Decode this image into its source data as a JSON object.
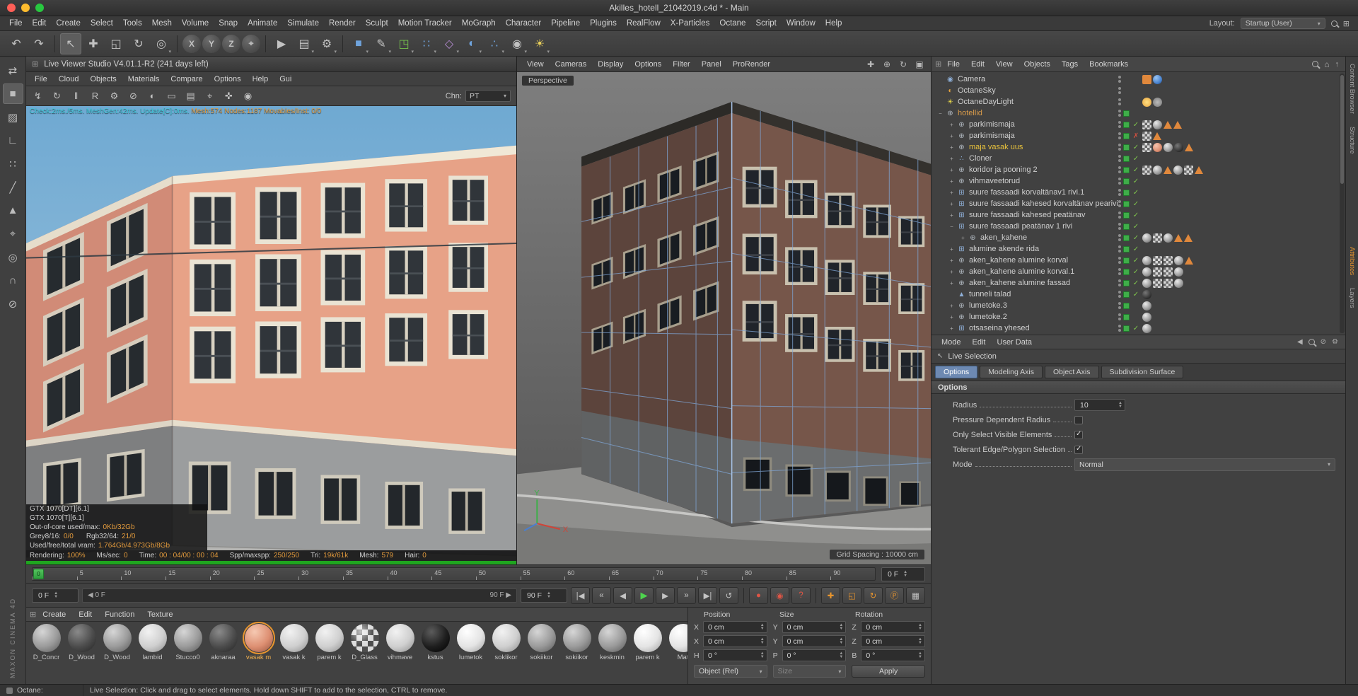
{
  "window": {
    "title": "Akilles_hotell_21042019.c4d * - Main"
  },
  "menu_bar": {
    "items": [
      "File",
      "Edit",
      "Create",
      "Select",
      "Tools",
      "Mesh",
      "Volume",
      "Snap",
      "Animate",
      "Simulate",
      "Render",
      "Sculpt",
      "Motion Tracker",
      "MoGraph",
      "Character",
      "Pipeline",
      "Plugins",
      "RealFlow",
      "X-Particles",
      "Octane",
      "Script",
      "Window",
      "Help"
    ],
    "layout_label": "Layout:",
    "layout_value": "Startup (User)"
  },
  "toolbar": {
    "buttons": [
      {
        "name": "undo-icon",
        "glyph": "↶"
      },
      {
        "name": "redo-icon",
        "glyph": "↷"
      },
      {
        "name": "separator",
        "cls": "sep"
      },
      {
        "name": "live-selection-tool-icon",
        "glyph": "↖",
        "cls": "active"
      },
      {
        "name": "move-tool-icon",
        "glyph": "✚"
      },
      {
        "name": "scale-tool-icon",
        "glyph": "◱"
      },
      {
        "name": "rotate-tool-icon",
        "glyph": "↻"
      },
      {
        "name": "last-used-tool-icon",
        "glyph": "◎",
        "caret": true
      },
      {
        "name": "separator",
        "cls": "sep"
      },
      {
        "name": "x-axis-lock-button",
        "glyph": "X",
        "cls": "axis"
      },
      {
        "name": "y-axis-lock-button",
        "glyph": "Y",
        "cls": "axis"
      },
      {
        "name": "z-axis-lock-button",
        "glyph": "Z",
        "cls": "axis"
      },
      {
        "name": "coordinate-system-button",
        "glyph": "⌖",
        "cls": "axis"
      },
      {
        "name": "separator",
        "cls": "sep"
      },
      {
        "name": "render-view-button",
        "glyph": "▶"
      },
      {
        "name": "render-picture-viewer-button",
        "glyph": "▤",
        "caret": true
      },
      {
        "name": "render-settings-button",
        "glyph": "⚙",
        "caret": true
      },
      {
        "name": "separator",
        "cls": "sep"
      },
      {
        "name": "primitive-cube-button",
        "glyph": "■",
        "cls": "c-blue",
        "caret": true
      },
      {
        "name": "spline-pen-button",
        "glyph": "✎",
        "caret": true
      },
      {
        "name": "subdivision-surface-button",
        "glyph": "◳",
        "cls": "c-green",
        "caret": true
      },
      {
        "name": "array-button",
        "glyph": "∷",
        "cls": "c-blue",
        "caret": true
      },
      {
        "name": "deformer-button",
        "glyph": "◇",
        "cls": "c-purple",
        "caret": true
      },
      {
        "name": "environment-button",
        "glyph": "◐",
        "cls": "c-blue",
        "caret": true
      },
      {
        "name": "mograph-button",
        "glyph": "∴",
        "cls": "c-blue",
        "caret": true
      },
      {
        "name": "camera-button",
        "glyph": "◉",
        "caret": true
      },
      {
        "name": "light-button",
        "glyph": "☀",
        "cls": "c-yellow",
        "caret": true
      }
    ]
  },
  "left_palette": {
    "tools": [
      {
        "name": "make-editable-icon",
        "glyph": "⇄"
      },
      {
        "name": "model-mode-icon",
        "glyph": "■",
        "cls": "active c-blue"
      },
      {
        "name": "texture-mode-icon",
        "glyph": "▨"
      },
      {
        "name": "workplane-mode-icon",
        "glyph": "∟"
      },
      {
        "name": "points-mode-icon",
        "glyph": "∷"
      },
      {
        "name": "edges-mode-icon",
        "glyph": "╱"
      },
      {
        "name": "polygons-mode-icon",
        "glyph": "▲"
      },
      {
        "name": "enable-axis-icon",
        "glyph": "⌖"
      },
      {
        "name": "viewport-solo-icon",
        "glyph": "◎"
      },
      {
        "name": "snap-icon",
        "glyph": "∩"
      },
      {
        "name": "lock-workplane-icon",
        "glyph": "⊘"
      }
    ]
  },
  "brand": {
    "text": "MAXON CINEMA 4D"
  },
  "live_viewer": {
    "title": "Live Viewer Studio V4.01.1-R2 (241 days left)",
    "menus": [
      "File",
      "Cloud",
      "Objects",
      "Materials",
      "Compare",
      "Options",
      "Help",
      "Gui"
    ],
    "toolbar": [
      {
        "name": "restart-render-icon",
        "glyph": "↯"
      },
      {
        "name": "refresh-render-icon",
        "glyph": "↻"
      },
      {
        "name": "pause-render-icon",
        "glyph": "‖"
      },
      {
        "name": "reset-render-button",
        "glyph": "R"
      },
      {
        "name": "settings-gear-icon",
        "glyph": "⚙"
      },
      {
        "name": "lock-resolution-icon",
        "glyph": "⊘"
      },
      {
        "name": "clay-mode-icon",
        "glyph": "◐"
      },
      {
        "name": "region-render-icon",
        "glyph": "▭"
      },
      {
        "name": "render-passes-icon",
        "glyph": "▤"
      },
      {
        "name": "focus-picker-icon",
        "glyph": "⌖"
      },
      {
        "name": "material-picker-icon",
        "glyph": "✜"
      },
      {
        "name": "camera-pin-icon",
        "glyph": "◉"
      }
    ],
    "chn_label": "Chn:",
    "chn_value": "PT",
    "overlay_left": "Check:2ms./5ms. MeshGen:42ms. Update[C]:0ms.",
    "overlay_right": "Mesh:574 Nodes:1187 Movables/Inst: 0/0",
    "gpu_rows": [
      "GTX 1070[DT][6.1]",
      "GTX 1070[T][6.1]"
    ],
    "memory_rows": [
      {
        "label": "Out-of-core used/max:",
        "value": "0Kb/32Gb",
        "label2": "",
        "value2": ""
      },
      {
        "label": "Grey8/16:",
        "value": "0/0",
        "label2": "Rgb32/64:",
        "value2": "21/0"
      },
      {
        "label": "Used/free/total vram:",
        "value": "1.764Gb/4.973Gb/8Gb",
        "label2": "",
        "value2": ""
      }
    ],
    "render_stats": [
      {
        "label": "Rendering:",
        "value": "100%"
      },
      {
        "label": "Ms/sec:",
        "value": "0"
      },
      {
        "label": "Time:",
        "value": "00 : 04/00 : 00 : 04"
      },
      {
        "label": "Spp/maxspp:",
        "value": "250/250"
      },
      {
        "label": "Tri:",
        "value": "19k/61k"
      },
      {
        "label": "Mesh:",
        "value": "579"
      },
      {
        "label": "Hair:",
        "value": "0"
      }
    ]
  },
  "viewport": {
    "menus": [
      "View",
      "Cameras",
      "Display",
      "Options",
      "Filter",
      "Panel",
      "ProRender"
    ],
    "corner_icons": [
      {
        "name": "pan-view-icon",
        "glyph": "✚"
      },
      {
        "name": "zoom-view-icon",
        "glyph": "⊕"
      },
      {
        "name": "rotate-view-icon",
        "glyph": "↻"
      },
      {
        "name": "maximize-view-icon",
        "glyph": "▣"
      }
    ],
    "label": "Perspective",
    "grid_spacing": "Grid Spacing : 10000 cm",
    "axis_x": "X",
    "axis_y": "Y"
  },
  "object_manager": {
    "menus": [
      "File",
      "Edit",
      "View",
      "Objects",
      "Tags",
      "Bookmarks"
    ],
    "items": [
      {
        "label": "Camera",
        "icon": "◉",
        "icls": "i-blue",
        "exp": "",
        "level": 0,
        "sq": false,
        "chk": "",
        "tags": [
          "comp",
          "blue"
        ]
      },
      {
        "label": "OctaneSky",
        "icon": "◐",
        "icls": "i-orange",
        "exp": "",
        "level": 0,
        "sq": false,
        "chk": "",
        "tags": []
      },
      {
        "label": "OctaneDayLight",
        "icon": "☀",
        "icls": "i-yellow",
        "exp": "",
        "level": 0,
        "sq": false,
        "chk": "",
        "tags": [
          "sun",
          "gear"
        ]
      },
      {
        "label": "hotellid",
        "icon": "⊕",
        "icls": "i-gray",
        "exp": "−",
        "level": 0,
        "color": "#d89b4a",
        "sq": true,
        "chk": "",
        "tags": []
      },
      {
        "label": "parkimismaja",
        "icon": "⊕",
        "icls": "i-gray",
        "exp": "+",
        "level": 1,
        "sq": true,
        "chk": "✓",
        "tags": [
          "check",
          "ball",
          "tri",
          "tri"
        ]
      },
      {
        "label": "parkimismaja",
        "icon": "⊕",
        "icls": "i-gray",
        "exp": "+",
        "level": 1,
        "sq": true,
        "chk": "✗",
        "cross": true,
        "tags": [
          "check",
          "tri"
        ]
      },
      {
        "label": "maja vasak uus",
        "icon": "⊕",
        "icls": "i-gray",
        "exp": "+",
        "level": 1,
        "color": "#e8c23c",
        "sq": true,
        "chk": "✓",
        "tags": [
          "check",
          "salmon",
          "ball",
          "dark",
          "tri"
        ]
      },
      {
        "label": "Cloner",
        "icon": "∴",
        "icls": "i-blue",
        "exp": "+",
        "level": 1,
        "sq": true,
        "chk": "✓",
        "tags": []
      },
      {
        "label": "koridor ja pooning 2",
        "icon": "⊕",
        "icls": "i-gray",
        "exp": "+",
        "level": 1,
        "sq": true,
        "chk": "✓",
        "tags": [
          "check",
          "ball",
          "tri",
          "ball",
          "check",
          "tri"
        ]
      },
      {
        "label": "vihmaveetorud",
        "icon": "⊕",
        "icls": "i-gray",
        "exp": "+",
        "level": 1,
        "sq": true,
        "chk": "✓",
        "tags": []
      },
      {
        "label": "suure fassaadi korvaltänav1 rivi.1",
        "icon": "⊞",
        "icls": "i-blue",
        "exp": "+",
        "level": 1,
        "sq": true,
        "chk": "✓",
        "tags": []
      },
      {
        "label": "suure fassaadi kahesed korvaltänav pearivi",
        "icon": "⊞",
        "icls": "i-blue",
        "exp": "+",
        "level": 1,
        "sq": true,
        "chk": "✓",
        "tags": []
      },
      {
        "label": "suure fassaadi kahesed peatänav",
        "icon": "⊞",
        "icls": "i-blue",
        "exp": "+",
        "level": 1,
        "sq": true,
        "chk": "✓",
        "tags": []
      },
      {
        "label": "suure fassaadi peatänav 1 rivi",
        "icon": "⊞",
        "icls": "i-blue",
        "exp": "−",
        "level": 1,
        "sq": true,
        "chk": "✓",
        "tags": []
      },
      {
        "label": "aken_kahene",
        "icon": "⊕",
        "icls": "i-gray",
        "exp": "+",
        "level": 2,
        "sq": true,
        "chk": "✓",
        "tags": [
          "ball",
          "check",
          "ball",
          "tri",
          "tri"
        ]
      },
      {
        "label": "alumine akende rida",
        "icon": "⊞",
        "icls": "i-blue",
        "exp": "+",
        "level": 1,
        "sq": true,
        "chk": "✓",
        "tags": []
      },
      {
        "label": "aken_kahene alumine korval",
        "icon": "⊕",
        "icls": "i-gray",
        "exp": "+",
        "level": 1,
        "sq": true,
        "chk": "✓",
        "tags": [
          "ball",
          "check",
          "check",
          "ball",
          "tri"
        ]
      },
      {
        "label": "aken_kahene alumine korval.1",
        "icon": "⊕",
        "icls": "i-gray",
        "exp": "+",
        "level": 1,
        "sq": true,
        "chk": "✓",
        "tags": [
          "ball",
          "check",
          "check",
          "ball"
        ]
      },
      {
        "label": "aken_kahene alumine fassad",
        "icon": "⊕",
        "icls": "i-gray",
        "exp": "+",
        "level": 1,
        "sq": true,
        "chk": "✓",
        "tags": [
          "ball",
          "check",
          "check",
          "ball"
        ]
      },
      {
        "label": "tunneli talad",
        "icon": "▲",
        "icls": "i-blue",
        "exp": "",
        "level": 1,
        "sq": true,
        "chk": "✓",
        "tags": [
          "dark"
        ]
      },
      {
        "label": "lumetoke.3",
        "icon": "⊕",
        "icls": "i-gray",
        "exp": "+",
        "level": 1,
        "sq": true,
        "chk": "",
        "tags": [
          "ball"
        ]
      },
      {
        "label": "lumetoke.2",
        "icon": "⊕",
        "icls": "i-gray",
        "exp": "+",
        "level": 1,
        "sq": true,
        "chk": "",
        "tags": [
          "ball"
        ]
      },
      {
        "label": "otsaseina yhesed",
        "icon": "⊞",
        "icls": "i-blue",
        "exp": "+",
        "level": 1,
        "sq": true,
        "chk": "✓",
        "tags": [
          "ball"
        ]
      }
    ]
  },
  "attributes": {
    "tabs": [
      "Mode",
      "Edit",
      "User Data"
    ],
    "title": "Live Selection",
    "sub_tabs": [
      {
        "label": "Options",
        "cls": "active",
        "name": "tab-options"
      },
      {
        "label": "Modeling Axis",
        "name": "tab-modeling-axis"
      },
      {
        "label": "Object Axis",
        "name": "tab-object-axis"
      },
      {
        "label": "Subdivision Surface",
        "name": "tab-subdivision-surface"
      }
    ],
    "section": "Options",
    "radius_label": "Radius",
    "radius_value": "10",
    "cb1_label": "Pressure Dependent Radius",
    "cb2_label": "Only Select Visible Elements",
    "cb3_label": "Tolerant Edge/Polygon Selection",
    "mode_label": "Mode",
    "mode_value": "Normal"
  },
  "side_tabs": {
    "top": [
      {
        "label": "Content Browser",
        "name": "side-tab-content-browser"
      },
      {
        "label": "Structure",
        "name": "side-tab-structure"
      }
    ],
    "bottom": [
      {
        "label": "Attributes",
        "cls": "active",
        "name": "side-tab-attributes"
      },
      {
        "label": "Layers",
        "name": "side-tab-layers"
      }
    ]
  },
  "timeline": {
    "ticks": [
      "0",
      "5",
      "10",
      "15",
      "20",
      "25",
      "30",
      "35",
      "40",
      "45",
      "50",
      "55",
      "60",
      "65",
      "70",
      "75",
      "80",
      "85",
      "90"
    ],
    "marker": "0",
    "current": "0 F"
  },
  "playbar": {
    "start_value": "0 F",
    "range_start": "0 F",
    "range_end": "90 F",
    "end_value": "90 F",
    "buttons": [
      {
        "name": "goto-start-button",
        "glyph": "|◀"
      },
      {
        "name": "prev-key-button",
        "glyph": "«"
      },
      {
        "name": "prev-frame-button",
        "glyph": "◀"
      },
      {
        "name": "play-button",
        "glyph": "▶",
        "cls": "play"
      },
      {
        "name": "next-frame-button",
        "glyph": "▶"
      },
      {
        "name": "next-key-button",
        "glyph": "»"
      },
      {
        "name": "goto-end-button",
        "glyph": "▶|"
      },
      {
        "name": "loop-button",
        "glyph": "↺"
      },
      {
        "name": "separator",
        "cls": "sep"
      },
      {
        "name": "record-keyframe-button",
        "glyph": "●",
        "cls": "red"
      },
      {
        "name": "autokey-button",
        "glyph": "◉",
        "cls": "red"
      },
      {
        "name": "keyframe-help-button",
        "glyph": "?",
        "cls": "red"
      },
      {
        "name": "separator",
        "cls": "sep"
      },
      {
        "name": "key-position-button",
        "glyph": "✚",
        "cls": "orange"
      },
      {
        "name": "key-scale-button",
        "glyph": "◱",
        "cls": "orange"
      },
      {
        "name": "key-rotation-button",
        "glyph": "↻",
        "cls": "orange"
      },
      {
        "name": "key-parameter-button",
        "glyph": "Ⓟ",
        "cls": "orange"
      },
      {
        "name": "timeline-grid-button",
        "glyph": "▦",
        "cls": "c-blue"
      }
    ]
  },
  "materials": {
    "menus": [
      "Create",
      "Edit",
      "Function",
      "Texture"
    ],
    "items": [
      {
        "label": "D_Concr",
        "cls": "m-gray"
      },
      {
        "label": "D_Wood",
        "cls": "m-dark"
      },
      {
        "label": "D_Wood",
        "cls": "m-gray"
      },
      {
        "label": "lambid",
        "cls": "m-light"
      },
      {
        "label": "Stucco0",
        "cls": "m-gray"
      },
      {
        "label": "aknaraa",
        "cls": "m-dark"
      },
      {
        "label": "vasak m",
        "cls": "m-salmon sel"
      },
      {
        "label": "vasak k",
        "cls": "m-light"
      },
      {
        "label": "parem k",
        "cls": "m-light"
      },
      {
        "label": "D_Glass",
        "cls": "m-checker"
      },
      {
        "label": "vihmave",
        "cls": "m-light"
      },
      {
        "label": "kstus",
        "cls": "m-black"
      },
      {
        "label": "lumetok",
        "cls": "m-white"
      },
      {
        "label": "soklikor",
        "cls": "m-light"
      },
      {
        "label": "sokiikor",
        "cls": "m-gray"
      },
      {
        "label": "sokiikor",
        "cls": "m-gray"
      },
      {
        "label": "keskmin",
        "cls": "m-gray"
      },
      {
        "label": "parem k",
        "cls": "m-white"
      },
      {
        "label": "Mat",
        "cls": "m-white"
      }
    ]
  },
  "coordinates": {
    "position_header": "Position",
    "size_header": "Size",
    "rotation_header": "Rotation",
    "position_rows": [
      {
        "axis": "X",
        "value": "0 cm"
      },
      {
        "axis": "Y",
        "value": "0 cm"
      },
      {
        "axis": "Z",
        "value": "0 cm"
      }
    ],
    "size_rows": [
      {
        "axis": "X",
        "value": "0 cm"
      },
      {
        "axis": "Y",
        "value": "0 cm"
      },
      {
        "axis": "Z",
        "value": "0 cm"
      }
    ],
    "rotation_rows": [
      {
        "axis": "H",
        "value": "0 °"
      },
      {
        "axis": "P",
        "value": "0 °"
      },
      {
        "axis": "B",
        "value": "0 °"
      }
    ],
    "object_mode": "Object (Rel)",
    "size_mode": "Size",
    "apply_label": "Apply"
  },
  "status_bar": {
    "octane_label": "Octane:",
    "message": "Live Selection: Click and drag to select elements. Hold down SHIFT to add to the selection, CTRL to remove."
  }
}
